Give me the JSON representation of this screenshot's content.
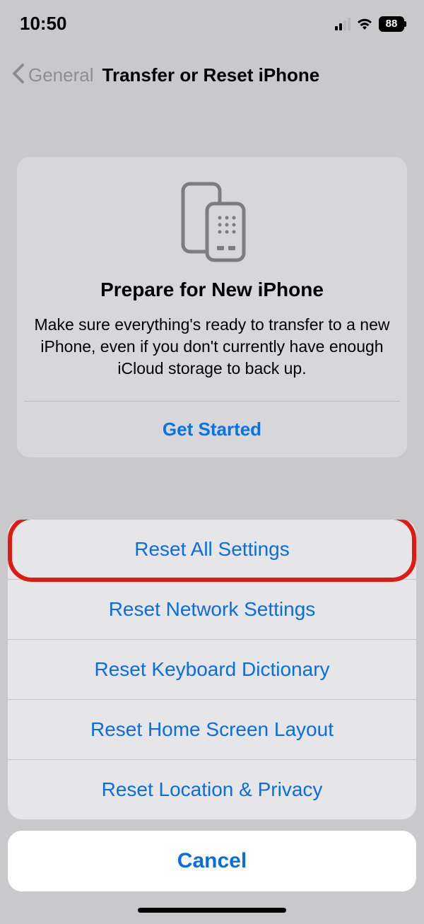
{
  "status": {
    "time": "10:50",
    "battery": "88"
  },
  "nav": {
    "back_label": "General",
    "title": "Transfer or Reset iPhone"
  },
  "card": {
    "title": "Prepare for New iPhone",
    "description": "Make sure everything's ready to transfer to a new iPhone, even if you don't currently have enough iCloud storage to back up.",
    "action": "Get Started"
  },
  "sheet": {
    "options": [
      "Reset All Settings",
      "Reset Network Settings",
      "Reset Keyboard Dictionary",
      "Reset Home Screen Layout",
      "Reset Location & Privacy"
    ],
    "cancel": "Cancel"
  }
}
